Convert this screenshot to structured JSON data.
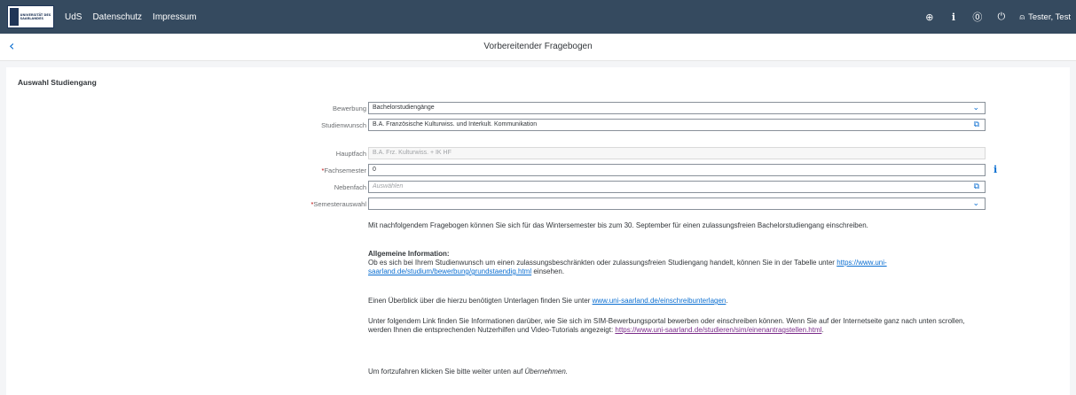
{
  "shell": {
    "logo_text": "UNIVERSITÄT DES SAARLANDES",
    "nav": [
      "UdS",
      "Datenschutz",
      "Impressum"
    ],
    "icons": [
      "globe-icon",
      "info-icon",
      "help-icon",
      "power-icon"
    ],
    "user_name": "Tester, Test"
  },
  "header": {
    "title": "Vorbereitender Fragebogen"
  },
  "section": {
    "title": "Auswahl Studiengang"
  },
  "form": {
    "bewerbung": {
      "label": "Bewerbung",
      "value": "Bachelorstudiengänge"
    },
    "studienwunsch": {
      "label": "Studienwunsch",
      "value": "B.A. Französische Kulturwiss. und Interkult. Kommunikation"
    },
    "hauptfach": {
      "label": "Hauptfach",
      "value": "B.A. Frz. Kulturwiss. + IK HF"
    },
    "fachsemester": {
      "required": "*",
      "label": "Fachsemester",
      "value": "0"
    },
    "nebenfach": {
      "label": "Nebenfach",
      "placeholder": "Auswählen"
    },
    "semesterauswahl": {
      "required": "*",
      "label": "Semesterauswahl",
      "value": ""
    }
  },
  "info_text": {
    "p1": "Mit nachfolgendem Fragebogen können Sie sich für das Wintersemester bis zum 30. September für einen zulassungsfreien Bachelorstudiengang einschreiben.",
    "heading": "Allgemeine Information:",
    "p2_start": "Ob es sich bei Ihrem Studienwunsch um einen zulassungsbeschränkten oder zulassungsfreien Studiengang handelt, können Sie in der Tabelle unter ",
    "p2_link": "https://www.uni-saarland.de/studium/bewerbung/grundstaendig.html",
    "p2_end": " einsehen.",
    "p3_start": "Einen Überblick über die hierzu benötigten Unterlagen finden Sie unter ",
    "p3_link": "www.uni-saarland.de/einschreibunterlagen",
    "p3_end": ".",
    "p4_start": "Unter folgendem Link finden Sie Informationen darüber, wie Sie sich im SIM-Bewerbungsportal bewerben oder einschreiben können. Wenn Sie auf der Internetseite ganz nach unten scrollen, werden Ihnen die entsprechenden Nutzerhilfen und Video-Tutorials angezeigt: ",
    "p4_link": "https://www.uni-saarland.de/studieren/sim/einenantragstellen.html",
    "p4_end": ".",
    "p5_start": "Um fortzufahren klicken Sie bitte weiter unten auf ",
    "p5_em": "Übernehmen."
  }
}
